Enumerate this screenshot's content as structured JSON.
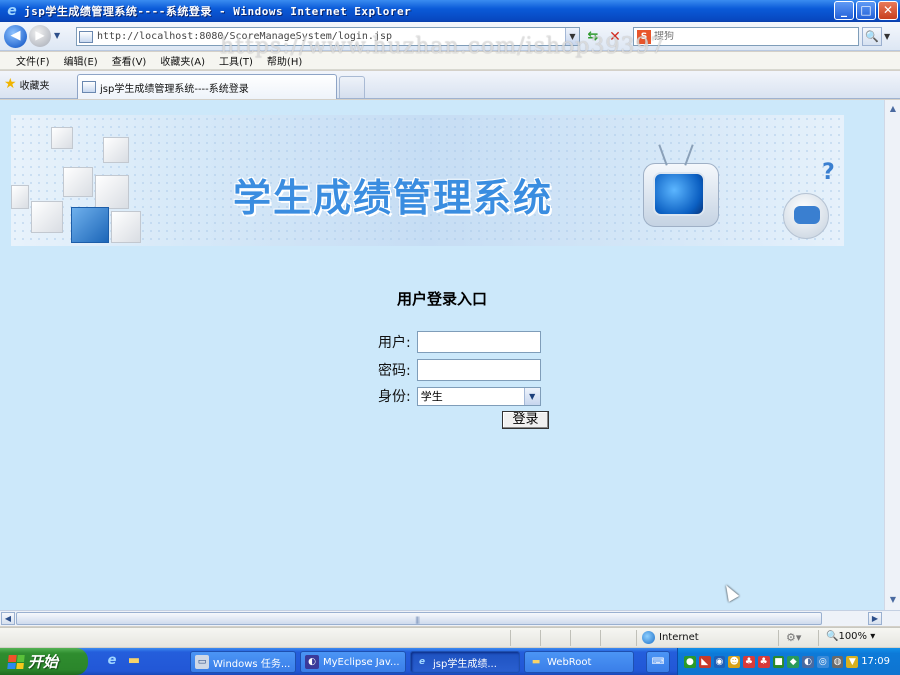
{
  "window": {
    "title": "jsp学生成绩管理系统----系统登录 - Windows Internet Explorer"
  },
  "address": {
    "url": "http://localhost:8080/ScoreManageSystem/login.jsp"
  },
  "search": {
    "placeholder": "搜狗"
  },
  "menu": {
    "items": [
      "文件(F)",
      "编辑(E)",
      "查看(V)",
      "收藏夹(A)",
      "工具(T)",
      "帮助(H)"
    ]
  },
  "favorites": {
    "label": "收藏夹"
  },
  "tab": {
    "label": "jsp学生成绩管理系统----系统登录"
  },
  "banner": {
    "title": "学生成绩管理系统"
  },
  "login": {
    "title": "用户登录入口",
    "user_label": "用户:",
    "password_label": "密码:",
    "role_label": "身份:",
    "role_selected": "学生",
    "submit_label": "登录"
  },
  "statusbar": {
    "zone": "Internet",
    "zoom": "100%"
  },
  "taskbar": {
    "start_label": "开始",
    "tasks": [
      {
        "label": "Windows 任务..."
      },
      {
        "label": "MyEclipse Jav..."
      },
      {
        "label": "jsp学生成绩..."
      },
      {
        "label": "WebRoot"
      }
    ],
    "clock": "17:09"
  },
  "watermark": "https://www.huzhan.com/ishop39397"
}
